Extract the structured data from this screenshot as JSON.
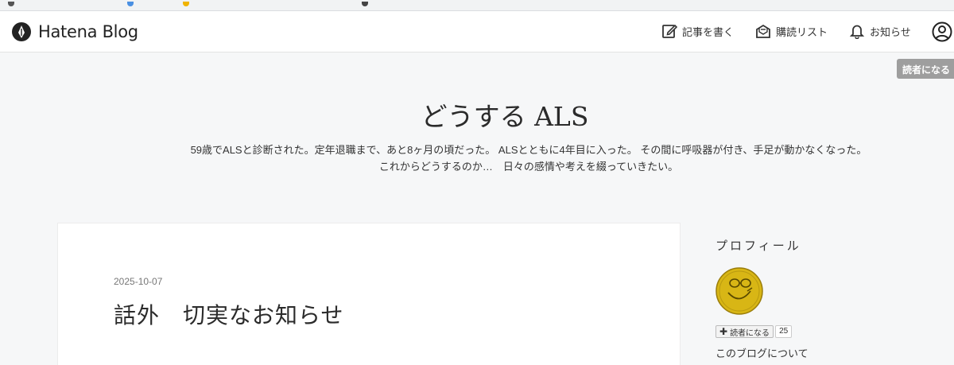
{
  "header": {
    "brand": "Hatena Blog",
    "nav": {
      "write": "記事を書く",
      "reading_list": "購読リスト",
      "notifications": "お知らせ"
    },
    "subscribe_float": "読者になる"
  },
  "blog": {
    "title": "どうする ALS",
    "description_line1": "59歳でALSと診断された。定年退職まで、あと8ヶ月の頃だった。 ALSとともに4年目に入った。 その間に呼吸器が付き、手足が動かなくなった。",
    "description_line2": "これからどうするのか…　日々の感情や考えを綴っていきたい。"
  },
  "entry": {
    "date": "2025-10-07",
    "title": "話外　切実なお知らせ"
  },
  "sidebar": {
    "profile_heading": "プロフィール",
    "subscribe_label": "読者になる",
    "subscriber_count": "25",
    "about_link": "このブログについて"
  },
  "colors": {
    "page_bg": "#f6f7f8",
    "header_bg": "#ffffff",
    "subscribe_float_bg": "#9e9e9e",
    "avatar_fill": "#d8b615"
  }
}
